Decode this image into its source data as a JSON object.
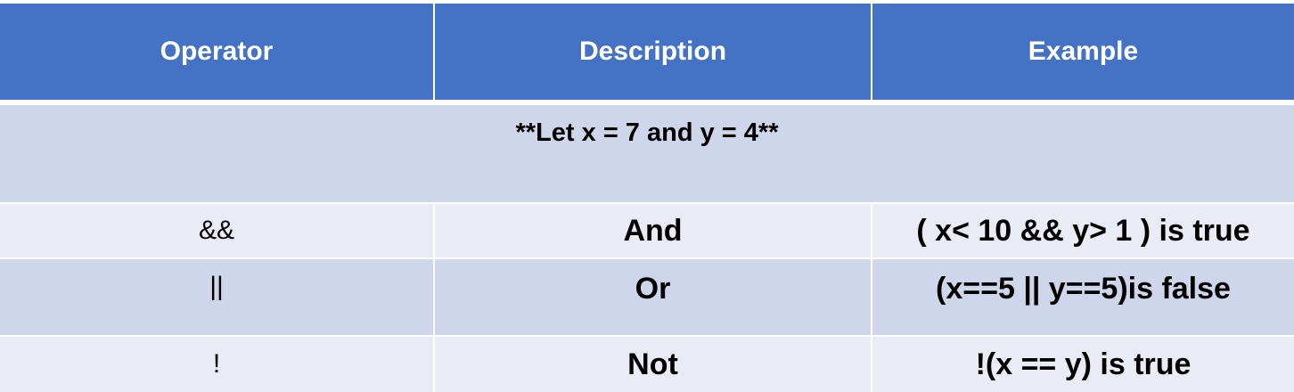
{
  "header": {
    "operator": "Operator",
    "description": "Description",
    "example": "Example"
  },
  "note": "**Let x = 7 and y = 4**",
  "rows": [
    {
      "operator": "&&",
      "description": "And",
      "example": "( x< 10 && y> 1 ) is true"
    },
    {
      "operator": "||",
      "description": "Or",
      "example": "(x==5 || y==5)is false"
    },
    {
      "operator": "!",
      "description": "Not",
      "example": "!(x == y) is true"
    }
  ],
  "colors": {
    "header_bg": "#4472c4",
    "band_dark": "#cfd5ea",
    "band_light": "#e9ebf5"
  }
}
